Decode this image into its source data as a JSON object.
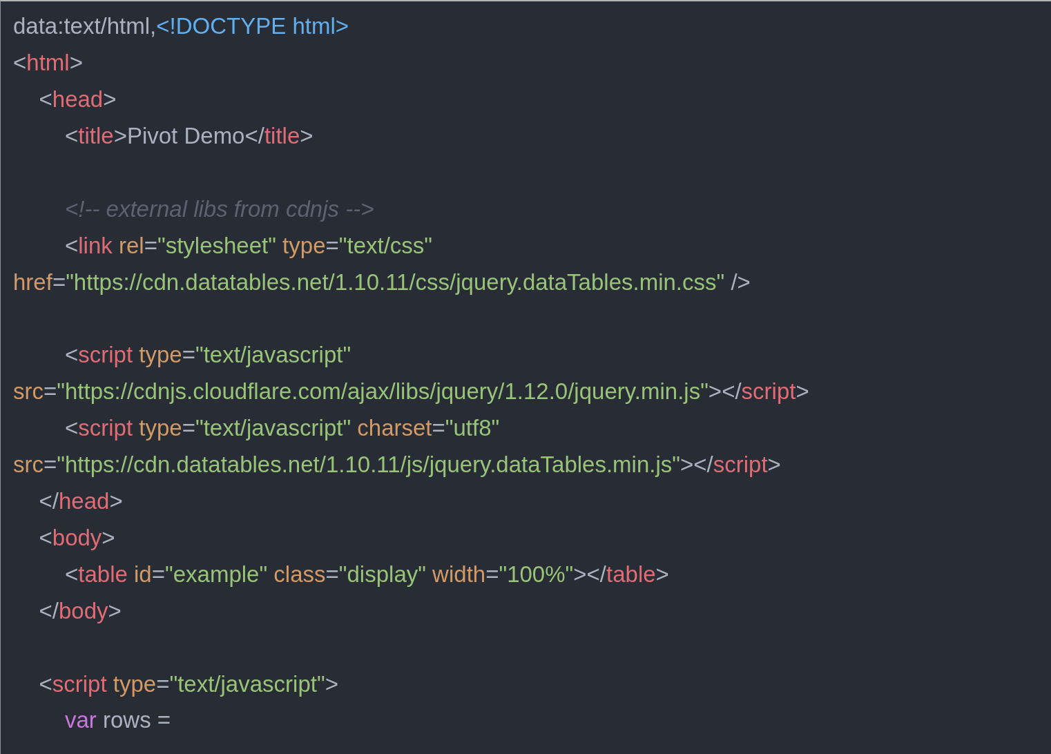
{
  "editor": {
    "lines": [
      {
        "kind": "code",
        "tokens": [
          {
            "text": "data:text/html,",
            "kind": "plain"
          },
          {
            "text": "<!DOCTYPE html>",
            "kind": "doctype"
          }
        ]
      },
      {
        "kind": "code",
        "tokens": [
          {
            "text": "<",
            "kind": "plain"
          },
          {
            "text": "html",
            "kind": "tag"
          },
          {
            "text": ">",
            "kind": "plain"
          }
        ],
        "children": [
          {
            "kind": "code",
            "tokens": [
              {
                "text": "<",
                "kind": "plain"
              },
              {
                "text": "head",
                "kind": "tag"
              },
              {
                "text": ">",
                "kind": "plain"
              }
            ],
            "children": [
              {
                "kind": "code",
                "tokens": [
                  {
                    "text": "<",
                    "kind": "plain"
                  },
                  {
                    "text": "title",
                    "kind": "tag"
                  },
                  {
                    "text": ">Pivot Demo</",
                    "kind": "plain"
                  },
                  {
                    "text": "title",
                    "kind": "tag"
                  },
                  {
                    "text": ">",
                    "kind": "plain"
                  }
                ]
              },
              {
                "kind": "blank"
              },
              {
                "kind": "code",
                "tokens": [
                  {
                    "text": "<!-- external libs from cdnjs -->",
                    "kind": "comment"
                  }
                ]
              },
              {
                "kind": "code",
                "tokens": [
                  {
                    "text": "<",
                    "kind": "plain"
                  },
                  {
                    "text": "link",
                    "kind": "tag"
                  },
                  {
                    "text": " rel",
                    "kind": "attribute"
                  },
                  {
                    "text": "=",
                    "kind": "plain"
                  },
                  {
                    "text": "\"stylesheet\"",
                    "kind": "string"
                  },
                  {
                    "text": " type",
                    "kind": "attribute"
                  },
                  {
                    "text": "=",
                    "kind": "plain"
                  },
                  {
                    "text": "\"text/css\"",
                    "kind": "string"
                  }
                ],
                "continuation": [
                  {
                    "text": "href",
                    "kind": "attribute"
                  },
                  {
                    "text": "=",
                    "kind": "plain"
                  },
                  {
                    "text": "\"https://cdn.datatables.net/1.10.11/css/jquery.dataTables.min.css\"",
                    "kind": "string"
                  },
                  {
                    "text": " />",
                    "kind": "plain"
                  }
                ]
              },
              {
                "kind": "blank"
              },
              {
                "kind": "code",
                "tokens": [
                  {
                    "text": "<",
                    "kind": "plain"
                  },
                  {
                    "text": "script",
                    "kind": "tag"
                  },
                  {
                    "text": " type",
                    "kind": "attribute"
                  },
                  {
                    "text": "=",
                    "kind": "plain"
                  },
                  {
                    "text": "\"text/javascript\"",
                    "kind": "string"
                  }
                ],
                "continuation": [
                  {
                    "text": "src",
                    "kind": "attribute"
                  },
                  {
                    "text": "=",
                    "kind": "plain"
                  },
                  {
                    "text": "\"https://cdnjs.cloudflare.com/ajax/libs/jquery/1.12.0/jquery.min.js\"",
                    "kind": "string"
                  },
                  {
                    "text": "></",
                    "kind": "plain"
                  },
                  {
                    "text": "script",
                    "kind": "tag"
                  },
                  {
                    "text": ">",
                    "kind": "plain"
                  }
                ]
              },
              {
                "kind": "code",
                "tokens": [
                  {
                    "text": "<",
                    "kind": "plain"
                  },
                  {
                    "text": "script",
                    "kind": "tag"
                  },
                  {
                    "text": " type",
                    "kind": "attribute"
                  },
                  {
                    "text": "=",
                    "kind": "plain"
                  },
                  {
                    "text": "\"text/javascript\"",
                    "kind": "string"
                  },
                  {
                    "text": " charset",
                    "kind": "attribute"
                  },
                  {
                    "text": "=",
                    "kind": "plain"
                  },
                  {
                    "text": "\"utf8\"",
                    "kind": "string"
                  }
                ],
                "continuation": [
                  {
                    "text": "src",
                    "kind": "attribute"
                  },
                  {
                    "text": "=",
                    "kind": "plain"
                  },
                  {
                    "text": "\"https://cdn.datatables.net/1.10.11/js/jquery.dataTables.min.js\"",
                    "kind": "string"
                  },
                  {
                    "text": "></",
                    "kind": "plain"
                  },
                  {
                    "text": "script",
                    "kind": "tag"
                  },
                  {
                    "text": ">",
                    "kind": "plain"
                  }
                ]
              }
            ]
          },
          {
            "kind": "code",
            "tokens": [
              {
                "text": "</",
                "kind": "plain"
              },
              {
                "text": "head",
                "kind": "tag"
              },
              {
                "text": ">",
                "kind": "plain"
              }
            ]
          },
          {
            "kind": "code",
            "tokens": [
              {
                "text": "<",
                "kind": "plain"
              },
              {
                "text": "body",
                "kind": "tag"
              },
              {
                "text": ">",
                "kind": "plain"
              }
            ],
            "children": [
              {
                "kind": "code",
                "tokens": [
                  {
                    "text": "<",
                    "kind": "plain"
                  },
                  {
                    "text": "table",
                    "kind": "tag"
                  },
                  {
                    "text": " id",
                    "kind": "attribute"
                  },
                  {
                    "text": "=",
                    "kind": "plain"
                  },
                  {
                    "text": "\"example\"",
                    "kind": "string"
                  },
                  {
                    "text": " class",
                    "kind": "attribute"
                  },
                  {
                    "text": "=",
                    "kind": "plain"
                  },
                  {
                    "text": "\"display\"",
                    "kind": "string"
                  },
                  {
                    "text": " width",
                    "kind": "attribute"
                  },
                  {
                    "text": "=",
                    "kind": "plain"
                  },
                  {
                    "text": "\"100%\"",
                    "kind": "string"
                  },
                  {
                    "text": "></",
                    "kind": "plain"
                  },
                  {
                    "text": "table",
                    "kind": "tag"
                  },
                  {
                    "text": ">",
                    "kind": "plain"
                  }
                ]
              }
            ]
          },
          {
            "kind": "code",
            "tokens": [
              {
                "text": "</",
                "kind": "plain"
              },
              {
                "text": "body",
                "kind": "tag"
              },
              {
                "text": ">",
                "kind": "plain"
              }
            ]
          },
          {
            "kind": "blank"
          },
          {
            "kind": "code",
            "tokens": [
              {
                "text": "<",
                "kind": "plain"
              },
              {
                "text": "script",
                "kind": "tag"
              },
              {
                "text": " type",
                "kind": "attribute"
              },
              {
                "text": "=",
                "kind": "plain"
              },
              {
                "text": "\"text/javascript\"",
                "kind": "string"
              },
              {
                "text": ">",
                "kind": "plain"
              }
            ],
            "children": [
              {
                "kind": "code",
                "tokens": [
                  {
                    "text": "var",
                    "kind": "keyword"
                  },
                  {
                    "text": " rows =",
                    "kind": "plain"
                  }
                ]
              }
            ]
          }
        ]
      }
    ]
  }
}
